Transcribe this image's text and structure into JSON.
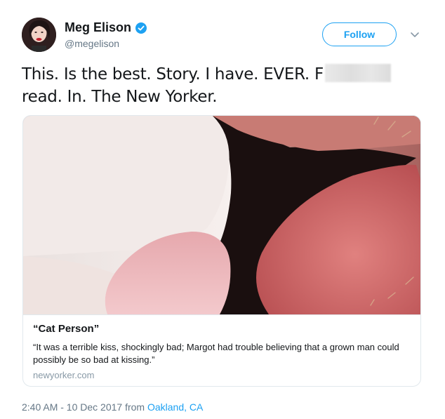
{
  "user": {
    "name": "Meg Elison",
    "handle": "@megelison",
    "verified": true,
    "avatar_icon": "avatar-photo"
  },
  "actions": {
    "follow_label": "Follow",
    "menu_icon": "chevron-down-icon"
  },
  "tweet": {
    "line1_start": "This. Is the best. Story. I have. EVER. F",
    "line2": "read. In. The New Yorker."
  },
  "card": {
    "title": "“Cat Person”",
    "description": "“It was a terrible kiss, shockingly bad; Margot had trouble believing that a grown man could possibly be so bad at kissing.”",
    "domain": "newyorker.com"
  },
  "meta": {
    "time_date": "2:40 AM - 10 Dec 2017 from ",
    "location": "Oakland, CA"
  },
  "colors": {
    "accent": "#1da1f2",
    "secondary_text": "#657786",
    "border": "#e1e8ed"
  }
}
